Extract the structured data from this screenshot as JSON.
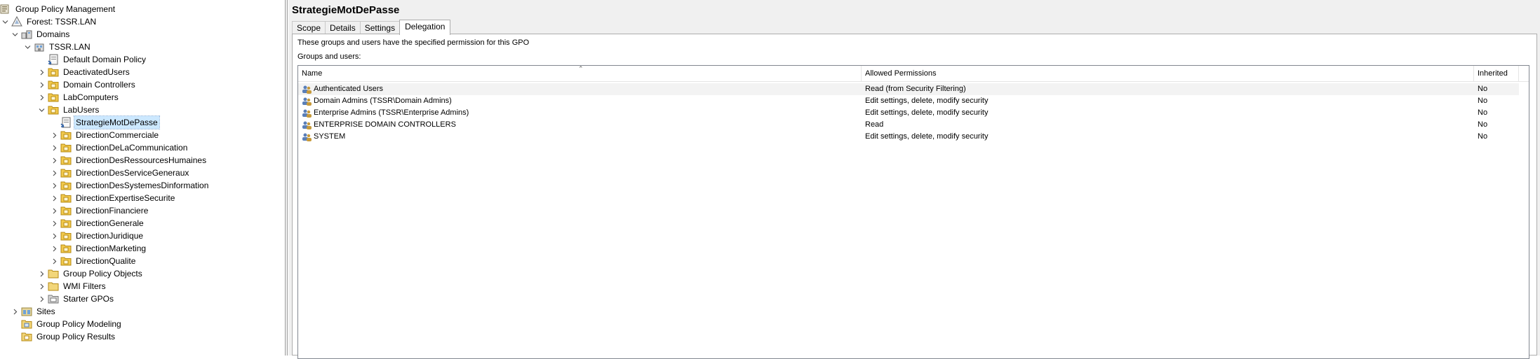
{
  "tree": {
    "nodes": [
      {
        "label": "Group Policy Management",
        "icon": "gpmc-icon"
      },
      {
        "label": "Forest: TSSR.LAN",
        "icon": "forest-icon"
      },
      {
        "label": "Domains",
        "icon": "domains-icon"
      },
      {
        "label": "TSSR.LAN",
        "icon": "domain-icon"
      },
      {
        "label": "Default Domain Policy",
        "icon": "gpo-link-icon"
      },
      {
        "label": "DeactivatedUsers",
        "icon": "ou-icon"
      },
      {
        "label": "Domain Controllers",
        "icon": "ou-icon"
      },
      {
        "label": "LabComputers",
        "icon": "ou-icon"
      },
      {
        "label": "LabUsers",
        "icon": "ou-icon"
      },
      {
        "label": "StrategieMotDePasse",
        "icon": "gpo-link-icon"
      },
      {
        "label": "DirectionCommerciale",
        "icon": "ou-icon"
      },
      {
        "label": "DirectionDeLaCommunication",
        "icon": "ou-icon"
      },
      {
        "label": "DirectionDesRessourcesHumaines",
        "icon": "ou-icon"
      },
      {
        "label": "DirectionDesServiceGeneraux",
        "icon": "ou-icon"
      },
      {
        "label": "DirectionDesSystemesDinformation",
        "icon": "ou-icon"
      },
      {
        "label": "DirectionExpertiseSecurite",
        "icon": "ou-icon"
      },
      {
        "label": "DirectionFinanciere",
        "icon": "ou-icon"
      },
      {
        "label": "DirectionGenerale",
        "icon": "ou-icon"
      },
      {
        "label": "DirectionJuridique",
        "icon": "ou-icon"
      },
      {
        "label": "DirectionMarketing",
        "icon": "ou-icon"
      },
      {
        "label": "DirectionQualite",
        "icon": "ou-icon"
      },
      {
        "label": "Group Policy Objects",
        "icon": "folder-icon"
      },
      {
        "label": "WMI Filters",
        "icon": "folder-icon"
      },
      {
        "label": "Starter GPOs",
        "icon": "starter-folder-icon"
      },
      {
        "label": "Sites",
        "icon": "sites-icon"
      },
      {
        "label": "Group Policy Modeling",
        "icon": "modeling-icon"
      },
      {
        "label": "Group Policy Results",
        "icon": "results-icon"
      }
    ],
    "selected": "StrategieMotDePasse"
  },
  "right": {
    "title": "StrategieMotDePasse",
    "tabs": [
      "Scope",
      "Details",
      "Settings",
      "Delegation"
    ],
    "active_tab": "Delegation",
    "description": "These groups and users have the specified permission for this GPO",
    "groups_label": "Groups and users:",
    "columns": [
      "Name",
      "Allowed Permissions",
      "Inherited"
    ],
    "rows": [
      {
        "name": "Authenticated Users",
        "permission": "Read (from Security Filtering)",
        "inherited": "No"
      },
      {
        "name": "Domain Admins (TSSR\\Domain Admins)",
        "permission": "Edit settings, delete, modify security",
        "inherited": "No"
      },
      {
        "name": "Enterprise Admins (TSSR\\Enterprise Admins)",
        "permission": "Edit settings, delete, modify security",
        "inherited": "No"
      },
      {
        "name": "ENTERPRISE DOMAIN CONTROLLERS",
        "permission": "Read",
        "inherited": "No"
      },
      {
        "name": "SYSTEM",
        "permission": "Edit settings, delete, modify security",
        "inherited": "No"
      }
    ]
  }
}
